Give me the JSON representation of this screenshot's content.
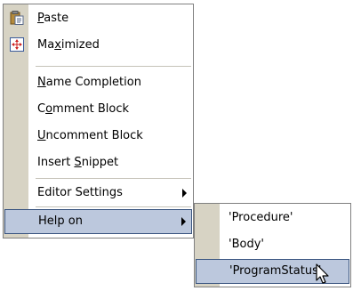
{
  "context_menu": {
    "items": [
      {
        "label": "Paste",
        "mnemonic_index": 0,
        "icon": "clipboard-paste-icon"
      },
      {
        "label": "Maximized",
        "mnemonic_index": 2,
        "icon": "maximize-arrows-icon"
      },
      {
        "label": "Name Completion",
        "mnemonic_index": 0
      },
      {
        "label": "Comment Block",
        "mnemonic_index": 1
      },
      {
        "label": "Uncomment Block",
        "mnemonic_index": 0
      },
      {
        "label": "Insert Snippet",
        "mnemonic_index": 7
      },
      {
        "label": "Editor Settings",
        "submenu": true
      },
      {
        "label": "Help on",
        "submenu": true,
        "highlighted": true
      }
    ]
  },
  "help_submenu": {
    "items": [
      {
        "label": "'Procedure'"
      },
      {
        "label": "'Body'"
      },
      {
        "label": "'ProgramStatus'",
        "highlighted": true
      }
    ]
  },
  "colors": {
    "gutter": "#d7d3c4",
    "highlight_fill": "#bcc8dd",
    "highlight_border": "#3a5580",
    "menu_border": "#808080"
  }
}
